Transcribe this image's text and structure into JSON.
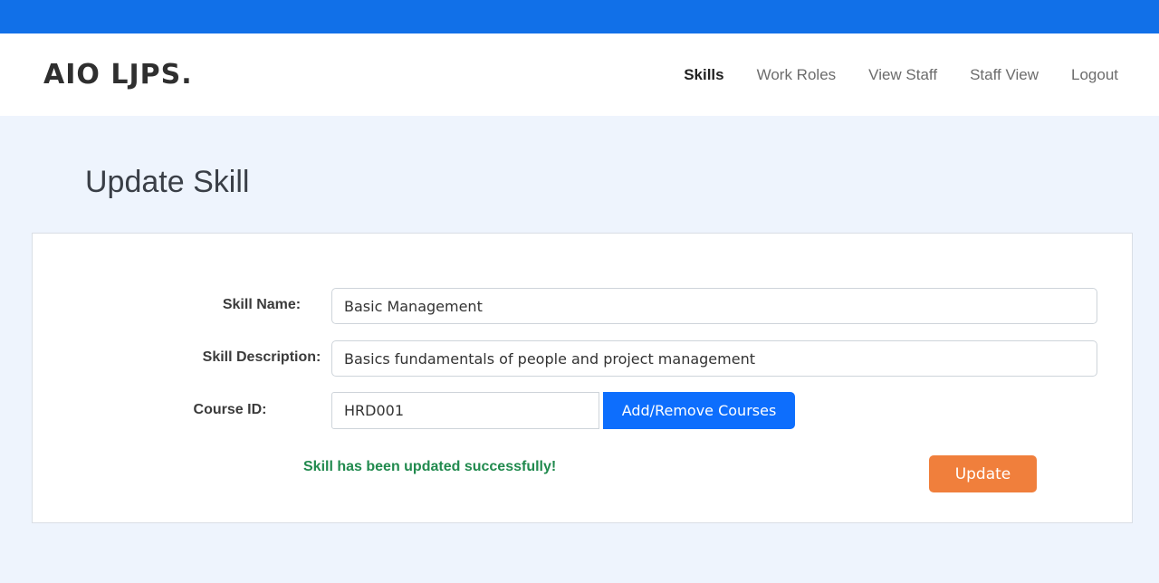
{
  "brand": "AIO LJPS.",
  "nav": {
    "items": [
      {
        "label": "Skills",
        "active": true
      },
      {
        "label": "Work Roles",
        "active": false
      },
      {
        "label": "View Staff",
        "active": false
      },
      {
        "label": "Staff View",
        "active": false
      },
      {
        "label": "Logout",
        "active": false
      }
    ]
  },
  "page": {
    "title": "Update Skill"
  },
  "form": {
    "skill_name_label": "Skill Name:",
    "skill_name_value": "Basic Management",
    "skill_description_label": "Skill Description:",
    "skill_description_value": "Basics fundamentals of people and project management",
    "course_id_label": "Course ID:",
    "course_id_value": "HRD001",
    "add_remove_label": "Add/Remove Courses",
    "success_message": "Skill has been updated successfully!",
    "update_label": "Update"
  },
  "colors": {
    "top_strip": "#1170e8",
    "page_background": "#eef4fd",
    "primary_button": "#0d6efd",
    "update_button": "#f07f3c",
    "success_text": "#218a4e"
  }
}
